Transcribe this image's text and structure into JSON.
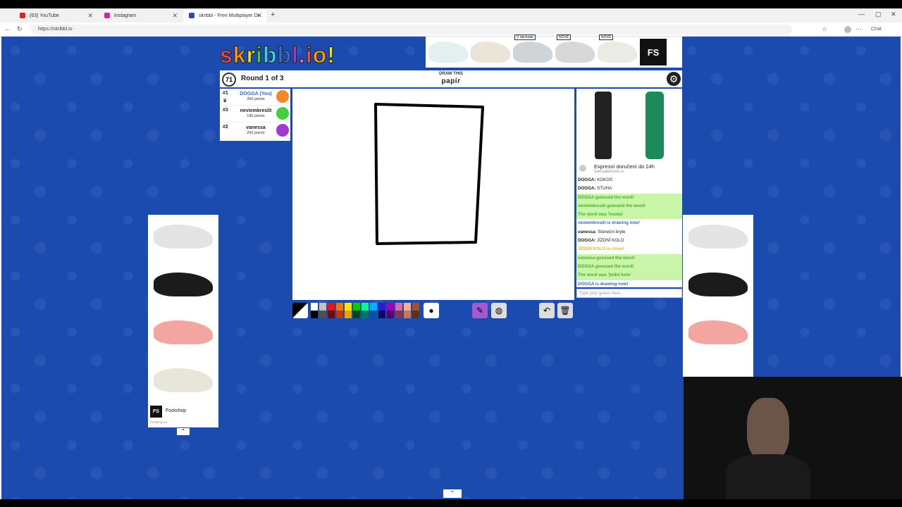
{
  "browser": {
    "tabs": [
      {
        "label": "(63) YouTube",
        "color": "#e62117"
      },
      {
        "label": "Instagram",
        "color": "#d6249f"
      },
      {
        "label": "skribbl - Free Multiplayer Drawing",
        "color": "#2a4db0"
      }
    ],
    "url": "https://skribbl.io",
    "chat_button": "Chat"
  },
  "game": {
    "logo": "skribbl.io",
    "timer": "71",
    "round": "Round 1 of 3",
    "draw_this": "DRAW THIS",
    "word": "papír",
    "players": [
      {
        "rank": "#1",
        "name": "DOGGA (You)",
        "points": "350 points",
        "color": "#3a6ad1",
        "avatar": "#f08a24"
      },
      {
        "rank": "#3",
        "name": "neviemkreslit",
        "points": "185 points",
        "color": "#222",
        "avatar": "#3fd13f"
      },
      {
        "rank": "#2",
        "name": "vanessa",
        "points": "260 points",
        "color": "#222",
        "avatar": "#a03ad1"
      }
    ],
    "chat": [
      {
        "name": "DOGGA:",
        "text": "KOKOS",
        "type": "normal"
      },
      {
        "name": "DOGGA:",
        "text": "STUHA",
        "type": "normal"
      },
      {
        "name": "",
        "text": "DOGGA guessed the word!",
        "type": "green"
      },
      {
        "name": "",
        "text": "neviemkreslit guessed the word!",
        "type": "green"
      },
      {
        "name": "",
        "text": "The word was 'houba'",
        "type": "green"
      },
      {
        "name": "",
        "text": "neviemkreslit is drawing now!",
        "type": "blue"
      },
      {
        "name": "vanessa:",
        "text": "Sluneční brýle",
        "type": "normal"
      },
      {
        "name": "DOGGA:",
        "text": "JÍZDNÍ KOLO",
        "type": "normal"
      },
      {
        "name": "",
        "text": "JÍZDNÍ KOLO is close!",
        "type": "yellow"
      },
      {
        "name": "",
        "text": "vanessa guessed the word!",
        "type": "green"
      },
      {
        "name": "",
        "text": "DOGGA guessed the word!",
        "type": "green"
      },
      {
        "name": "",
        "text": "The word was 'jízdní kolo'",
        "type": "green"
      },
      {
        "name": "",
        "text": "DOGGA is drawing now!",
        "type": "blue"
      }
    ],
    "chat_placeholder": "Type your guess here...",
    "palette": [
      "#ffffff",
      "#c1c1c1",
      "#ef130b",
      "#ff7100",
      "#ffe400",
      "#00cc00",
      "#00ff91",
      "#00b2ff",
      "#231fd3",
      "#a300ba",
      "#df69a7",
      "#ffac8e",
      "#a0522d",
      "#000000",
      "#505050",
      "#740b07",
      "#c23800",
      "#e8a200",
      "#004619",
      "#00785d",
      "#00569e",
      "#0e0865",
      "#550069",
      "#873554",
      "#cc774d",
      "#63300d"
    ]
  },
  "ads": {
    "top_badges": [
      "V obchode",
      "NOVÉ",
      "NOVÉ"
    ],
    "top_brand": "FS",
    "right_title": "Expresní doručení do 24h",
    "right_sub": "Svět kadeřnictví.cz",
    "left_brand": "Footshop",
    "left_sub": "Footshop.cz",
    "left_logo": "FS"
  }
}
